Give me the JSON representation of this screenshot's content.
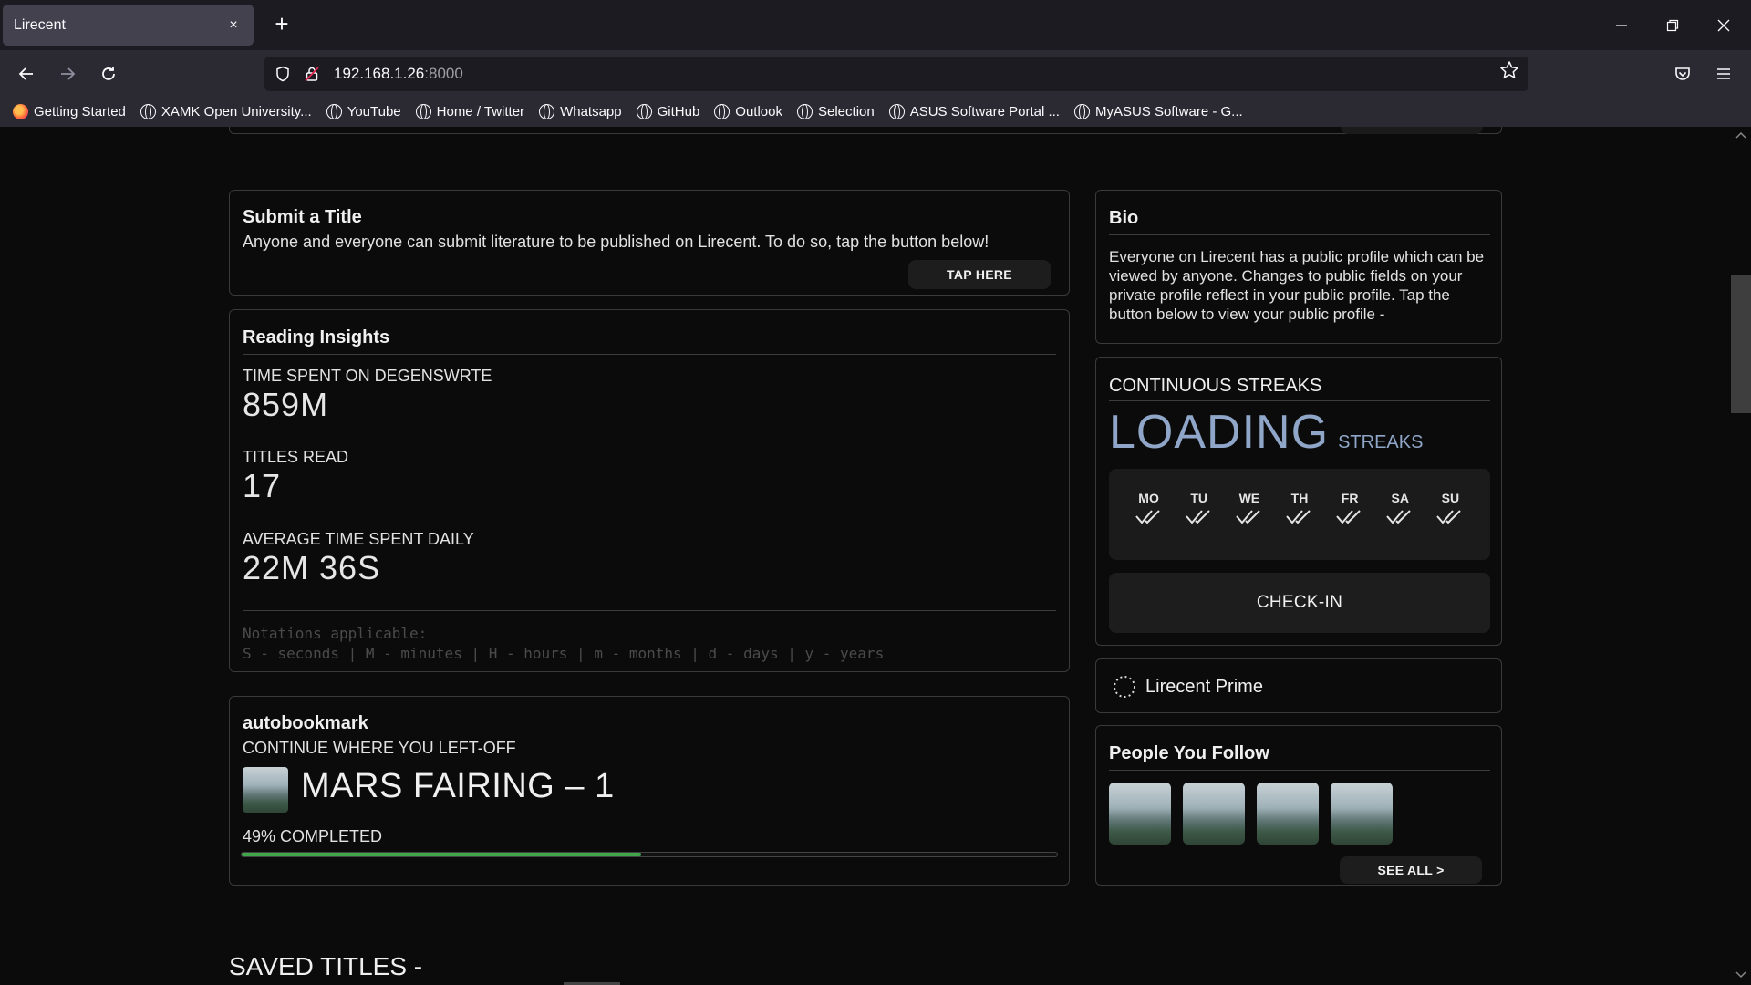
{
  "browser": {
    "tab_title": "Lirecent",
    "tab_close": "×",
    "new_tab": "+",
    "url_host": "192.168.1.26",
    "url_port": ":8000",
    "bookmarks": [
      "Getting Started",
      "XAMK Open University...",
      "YouTube",
      "Home / Twitter",
      "Whatsapp",
      "GitHub",
      "Outlook",
      "Selection",
      "ASUS Software Portal ...",
      "MyASUS Software - G..."
    ]
  },
  "submit": {
    "title": "Submit a Title",
    "text": "Anyone and everyone can submit literature to be published on Lirecent. To do so, tap the button below!",
    "button": "TAP HERE"
  },
  "insights": {
    "title": "Reading Insights",
    "time_label": "TIME SPENT ON DEGENSWRTE",
    "time_value": "859M",
    "titles_label": "TITLES READ",
    "titles_value": "17",
    "avg_label": "AVERAGE TIME SPENT DAILY",
    "avg_value": "22M 36S",
    "notation_1": "Notations applicable:",
    "notation_2": "S - seconds | M - minutes | H - hours | m - months | d - days | y - years"
  },
  "bookmark": {
    "title": "autobookmark",
    "subtitle": "CONTINUE WHERE YOU LEFT-OFF",
    "book": "MARS FAIRING – 1",
    "progress_label": "49% COMPLETED",
    "progress_fraction": 0.49,
    "progress_color": "#3fa64a"
  },
  "bio": {
    "title": "Bio",
    "text": "Everyone on Lirecent has a public profile which can be viewed by anyone. Changes to public fields on your private profile reflect in your public profile. Tap the button below to view your public profile -"
  },
  "streaks": {
    "title": "CONTINUOUS STREAKS",
    "value": "LOADING",
    "unit": "STREAKS",
    "accent": "#8fa6c8",
    "days": [
      "MO",
      "TU",
      "WE",
      "TH",
      "FR",
      "SA",
      "SU"
    ],
    "checkin": "CHECK-IN"
  },
  "prime": {
    "title": "Lirecent Prime"
  },
  "follow": {
    "title": "People You Follow",
    "see_all": "SEE ALL >"
  },
  "saved": {
    "title": "SAVED TITLES -"
  }
}
